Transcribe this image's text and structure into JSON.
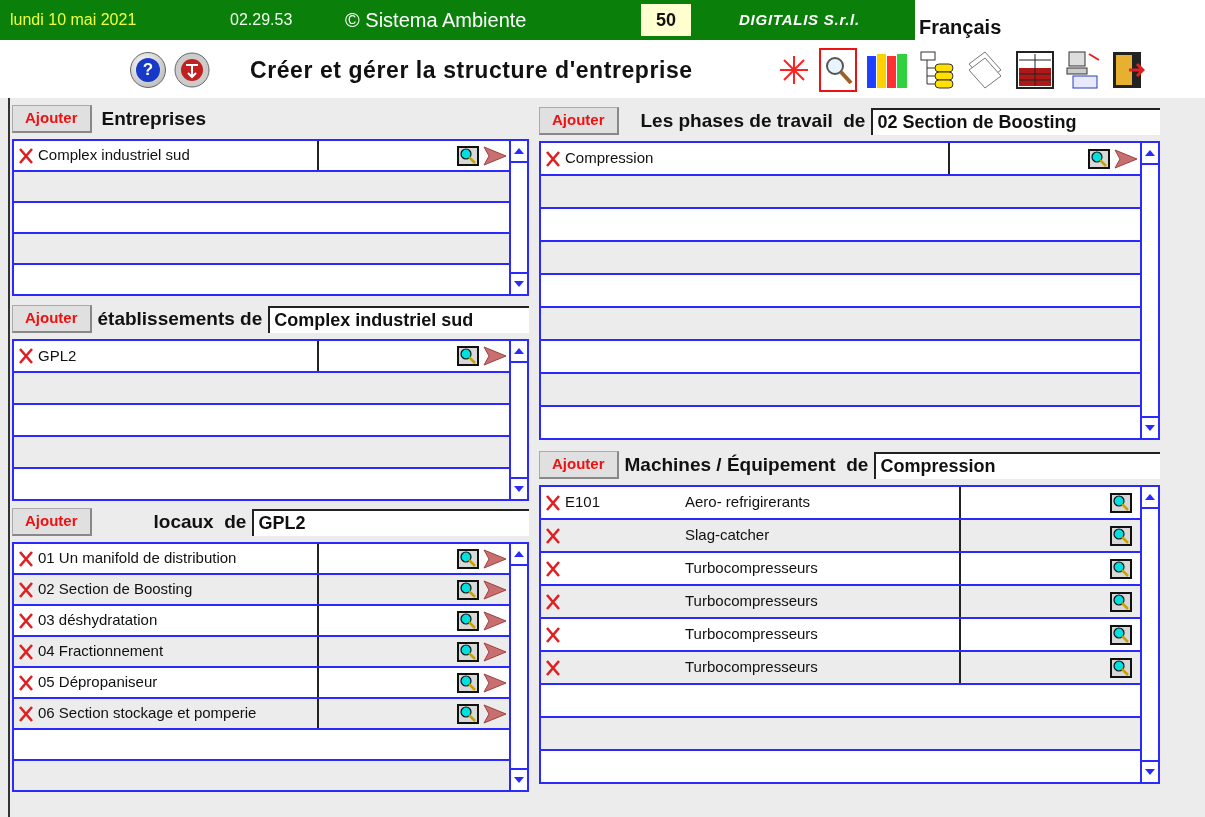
{
  "header": {
    "date": "lundi 10 mai 2021",
    "time": "02.29.53",
    "brand": "© Sistema Ambiente",
    "count": "50",
    "company": "DIGITALIS S.r.l.",
    "language": "Français"
  },
  "toolbar": {
    "help_glyph": "?",
    "title": "Créer et gérer la structure d'entreprise",
    "tools": [
      {
        "kind": "snowflake",
        "selected": false
      },
      {
        "kind": "search",
        "selected": true
      },
      {
        "kind": "books",
        "selected": false
      },
      {
        "kind": "tree",
        "selected": false
      },
      {
        "kind": "documents",
        "selected": false
      },
      {
        "kind": "grid",
        "selected": false
      },
      {
        "kind": "computer",
        "selected": false
      },
      {
        "kind": "exit",
        "selected": false
      }
    ]
  },
  "panels": [
    {
      "kind": "list",
      "add_button": "Ajouter",
      "label": "Entreprises",
      "rows": [
        {
          "name": "Complex industriel sud"
        }
      ]
    },
    {
      "kind": "list",
      "add_button": "Ajouter",
      "label": "établissements de",
      "context": "Complex industriel sud",
      "rows": [
        {
          "name": "GPL2"
        }
      ]
    },
    {
      "kind": "list",
      "add_button": "Ajouter",
      "label": "locaux  de",
      "context": "GPL2",
      "rows": [
        {
          "name": "01 Un manifold de distribution"
        },
        {
          "name": "02 Section de Boosting"
        },
        {
          "name": "03 déshydratation"
        },
        {
          "name": "04 Fractionnement"
        },
        {
          "name": "05 Dépropaniseur"
        },
        {
          "name": "06  Section stockage et pomperie"
        }
      ]
    },
    {
      "kind": "list",
      "add_button": "Ajouter",
      "label": "Les phases de travail  de",
      "context": "02 Section de Boosting",
      "rows": [
        {
          "name": "Compression"
        }
      ]
    },
    {
      "kind": "machines",
      "add_button": "Ajouter",
      "label": "Machines / Équipement  de",
      "context": "Compression",
      "rows": [
        {
          "code": "E101",
          "name": "Aero- refrigirerants"
        },
        {
          "name": "Slag-catcher"
        },
        {
          "name": "Turbocompresseurs"
        },
        {
          "name": "Turbocompresseurs"
        },
        {
          "name": "Turbocompresseurs"
        },
        {
          "name": "Turbocompresseurs"
        }
      ]
    }
  ]
}
